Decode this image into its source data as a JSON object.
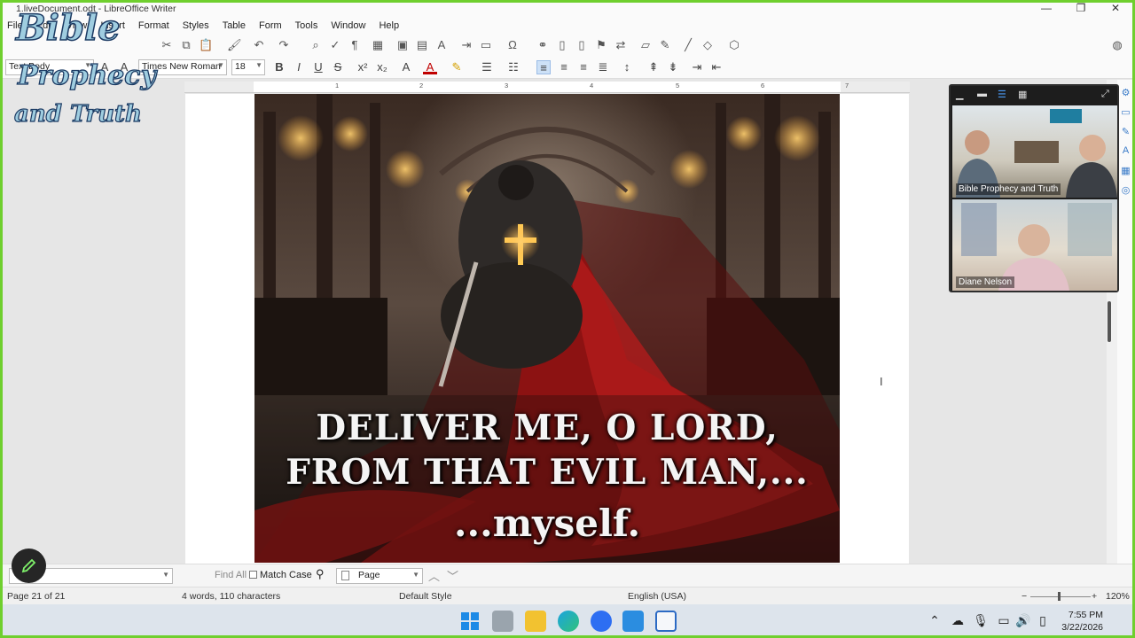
{
  "window": {
    "title": "1.liveDocument.odt - LibreOffice Writer",
    "minimize": "—",
    "restore": "❐",
    "close": "✕"
  },
  "menu": [
    "File",
    "Edit",
    "View",
    "Insert",
    "Format",
    "Styles",
    "Table",
    "Form",
    "Tools",
    "Window",
    "Help"
  ],
  "logo": {
    "line1": "Bible",
    "line2": "Prophecy",
    "line3": "and Truth"
  },
  "formatting": {
    "paragraph_style": "Text Body",
    "font_name": "Times New Roman",
    "font_size": "18"
  },
  "ruler": {
    "marks": [
      "1",
      "2",
      "3",
      "4",
      "5",
      "6",
      "7"
    ]
  },
  "document": {
    "caption_line1": "DELIVER ME, O LORD,",
    "caption_line2": "FROM THAT EVIL MAN,...",
    "caption_line3": "...myself."
  },
  "video_call": {
    "participant1": "Bible Prophecy and Truth",
    "participant2": "Diane Nelson"
  },
  "find_bar": {
    "input_value": "",
    "find_all_label": "Find All",
    "match_case_label": "Match Case",
    "search_scope": "Page"
  },
  "status": {
    "page": "Page 21 of 21",
    "word_count": "4 words, 110 characters",
    "page_style": "Default Style",
    "language": "English (USA)",
    "zoom": "120%",
    "zoom_minus": "−",
    "zoom_plus": "+"
  },
  "taskbar": {
    "time": "7:55 PM",
    "date": "3/22/2026"
  },
  "colors": {
    "frame_border": "#6fcf2e",
    "logo_fill": "#9fcde0",
    "logo_outline": "#1b3a63",
    "accent": "#3a7bc8"
  }
}
